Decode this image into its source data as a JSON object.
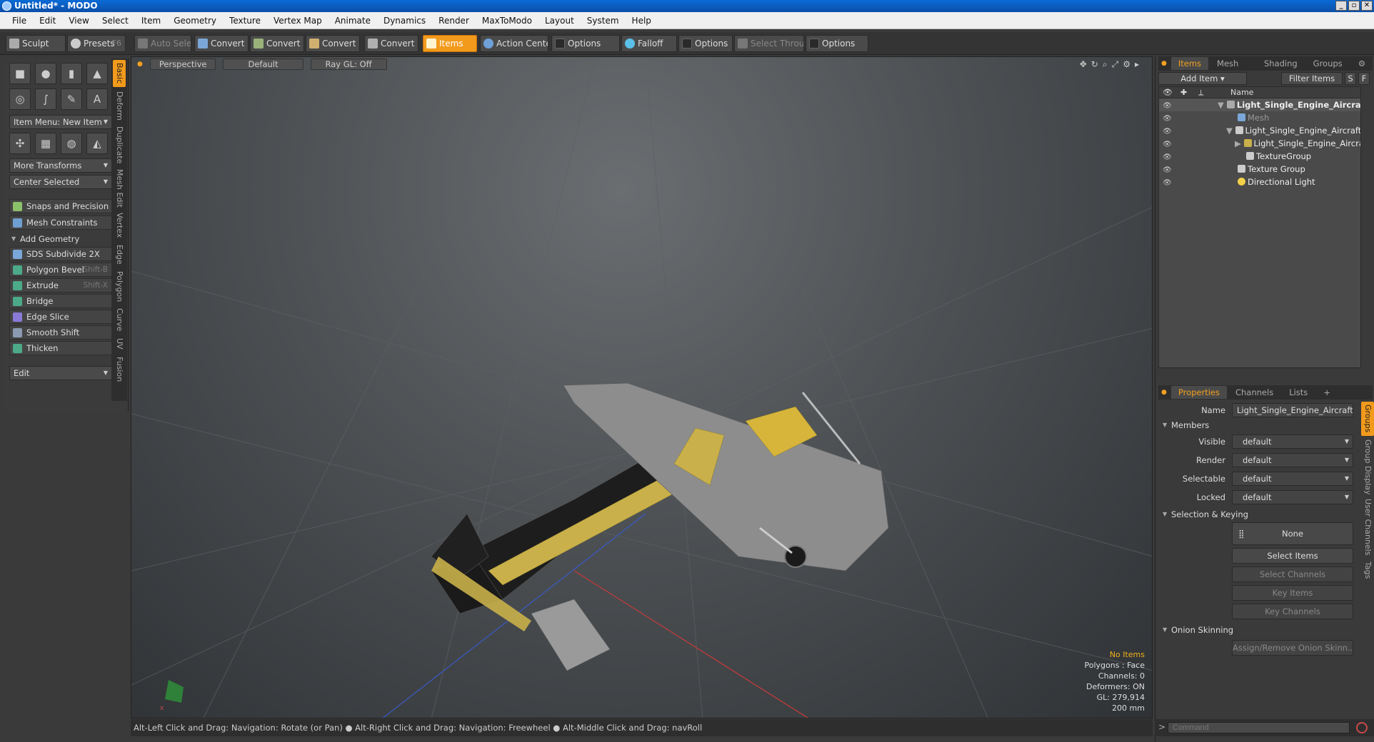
{
  "window": {
    "title": "Untitled* - MODO"
  },
  "menu": [
    "File",
    "Edit",
    "View",
    "Select",
    "Item",
    "Geometry",
    "Texture",
    "Vertex Map",
    "Animate",
    "Dynamics",
    "Render",
    "MaxToModo",
    "Layout",
    "System",
    "Help"
  ],
  "toolbar": {
    "sculpt": "Sculpt",
    "presets": "Presets",
    "presets_key": "F6",
    "auto_select": "Auto Select",
    "convert1": "Convert",
    "convert2": "Convert",
    "convert3": "Convert",
    "convert4": "Convert",
    "items": "Items",
    "action_center": "Action Center",
    "options1": "Options",
    "falloff": "Falloff",
    "options2": "Options",
    "select_through": "Select Through",
    "options3": "Options"
  },
  "left_tabs": [
    "Basic",
    "Deform",
    "Duplicate",
    "Mesh Edit",
    "Vertex",
    "Edge",
    "Polygon",
    "Curve",
    "UV",
    "Fusion"
  ],
  "left": {
    "item_menu": "Item Menu: New Item",
    "more_transforms": "More Transforms",
    "center_selected": "Center Selected",
    "snaps": "Snaps and Precision",
    "mesh_constraints": "Mesh Constraints",
    "add_geometry": "Add Geometry",
    "tools": [
      {
        "label": "SDS Subdivide 2X",
        "key": ""
      },
      {
        "label": "Polygon Bevel",
        "key": "Shift-B"
      },
      {
        "label": "Extrude",
        "key": "Shift-X"
      },
      {
        "label": "Bridge",
        "key": ""
      },
      {
        "label": "Edge Slice",
        "key": ""
      },
      {
        "label": "Smooth Shift",
        "key": ""
      },
      {
        "label": "Thicken",
        "key": ""
      }
    ],
    "edit": "Edit"
  },
  "viewport": {
    "perspective": "Perspective",
    "default": "Default",
    "raygl": "Ray GL: Off",
    "info": {
      "no_items": "No Items",
      "polygons": "Polygons : Face",
      "channels": "Channels: 0",
      "deformers": "Deformers: ON",
      "gl": "GL: 279,914",
      "scale": "200 mm"
    }
  },
  "status": "Alt-Left Click and Drag: Navigation: Rotate (or Pan) ● Alt-Right Click and Drag: Navigation: Freewheel ● Alt-Middle Click and Drag: navRoll",
  "items_panel": {
    "tabs": [
      "Items",
      "Mesh ...",
      "Shading",
      "Groups"
    ],
    "add_item": "Add Item",
    "filter_items": "Filter Items",
    "s": "S",
    "f": "F",
    "col_name": "Name",
    "rows": [
      {
        "label": "Light_Single_Engine_Aircra ..."
      },
      {
        "label": "Mesh"
      },
      {
        "label": "Light_Single_Engine_Aircraft_..."
      },
      {
        "label": "Light_Single_Engine_Aircraf..."
      },
      {
        "label": "TextureGroup"
      },
      {
        "label": "Texture Group"
      },
      {
        "label": "Directional Light"
      }
    ]
  },
  "properties": {
    "tabs": [
      "Properties",
      "Channels",
      "Lists",
      "+"
    ],
    "name_label": "Name",
    "name_value": "Light_Single_Engine_Aircraft_Ger",
    "members": "Members",
    "visible_label": "Visible",
    "visible": "default",
    "render_label": "Render",
    "render": "default",
    "selectable_label": "Selectable",
    "selectable": "default",
    "locked_label": "Locked",
    "locked": "default",
    "selection_keying": "Selection & Keying",
    "none": "None",
    "select_items": "Select Items",
    "select_channels": "Select Channels",
    "key_items": "Key Items",
    "key_channels": "Key Channels",
    "onion": "Onion Skinning",
    "assign_onion": "Assign/Remove Onion Skinn...",
    "side_tabs": [
      "Groups",
      "Group Display",
      "User Channels",
      "Tags"
    ]
  },
  "command": {
    "placeholder": "Command"
  }
}
